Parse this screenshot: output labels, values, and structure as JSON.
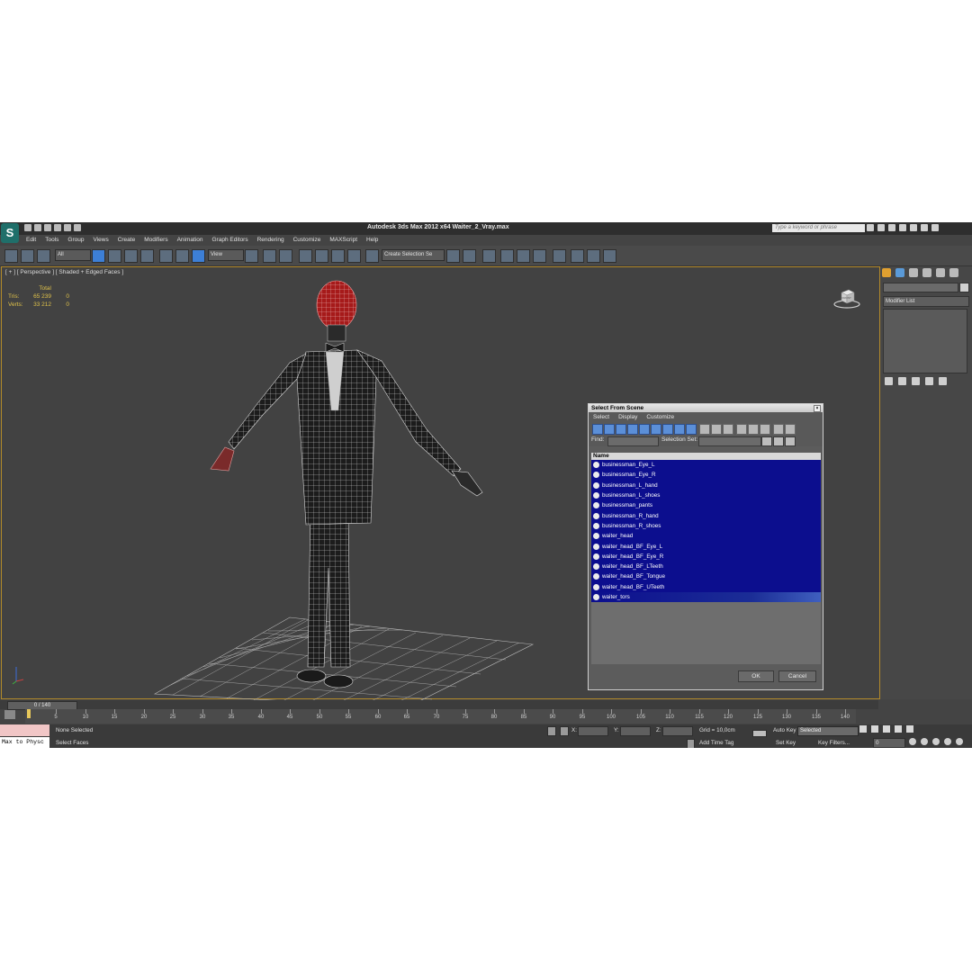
{
  "app": {
    "title": "Autodesk 3ds Max  2012 x64      Waiter_2_Vray.max",
    "logo": "3ds-max-logo",
    "search_placeholder": "Type a keyword or phrase"
  },
  "menu": [
    "Edit",
    "Tools",
    "Group",
    "Views",
    "Create",
    "Modifiers",
    "Animation",
    "Graph Editors",
    "Rendering",
    "Customize",
    "MAXScript",
    "Help"
  ],
  "toolbar": {
    "selection_filter": "All",
    "reference_coord": "View",
    "named_selection": "Create Selection Se",
    "snap_value": "3"
  },
  "viewport": {
    "label": "[ + ] [ Perspective ] [ Shaded + Edged Faces ]",
    "stats": {
      "header": "Total",
      "rows": [
        {
          "label": "Tris:",
          "total": "65 239",
          "sel": "0"
        },
        {
          "label": "Verts:",
          "total": "33 212",
          "sel": "0"
        }
      ]
    },
    "viewcube_label": "FRONT"
  },
  "dialog": {
    "title": "Select From Scene",
    "menu": [
      "Select",
      "Display",
      "Customize"
    ],
    "find_label": "Find:",
    "selection_set_label": "Selection Set:",
    "column_header": "Name",
    "items": [
      "businessman_Eye_L",
      "businessman_Eye_R",
      "businessman_L_hand",
      "businessman_L_shoes",
      "businessman_pants",
      "businessman_R_hand",
      "businessman_R_shoes",
      "waiter_head",
      "waiter_head_BF_Eye_L",
      "waiter_head_BF_Eye_R",
      "waiter_head_BF_LTeeth",
      "waiter_head_BF_Tongue",
      "waiter_head_BF_UTeeth",
      "waiter_tors"
    ],
    "ok_label": "OK",
    "cancel_label": "Cancel"
  },
  "command_panel": {
    "modifier_list": "Modifier List"
  },
  "timeline": {
    "slider_label": "0 / 140",
    "ticks": [
      "5",
      "10",
      "15",
      "20",
      "25",
      "30",
      "35",
      "40",
      "45",
      "50",
      "55",
      "60",
      "65",
      "70",
      "75",
      "80",
      "85",
      "90",
      "95",
      "100",
      "105",
      "110",
      "115",
      "120",
      "125",
      "130",
      "135",
      "140"
    ]
  },
  "status": {
    "selection": "None Selected",
    "prompt": "Select Faces",
    "max_to_physc": "Max to Physc",
    "x_label": "X:",
    "y_label": "Y:",
    "z_label": "Z:",
    "grid": "Grid = 10,0cm",
    "add_time_tag": "Add Time Tag",
    "auto_key": "Auto Key",
    "set_key": "Set Key",
    "selected": "Selected",
    "key_filters": "Key Filters...",
    "frame": "0"
  },
  "colors": {
    "viewport_border": "#b38a2a",
    "list_selection": "#0c0e8e",
    "stats_text": "#e0c24a"
  }
}
